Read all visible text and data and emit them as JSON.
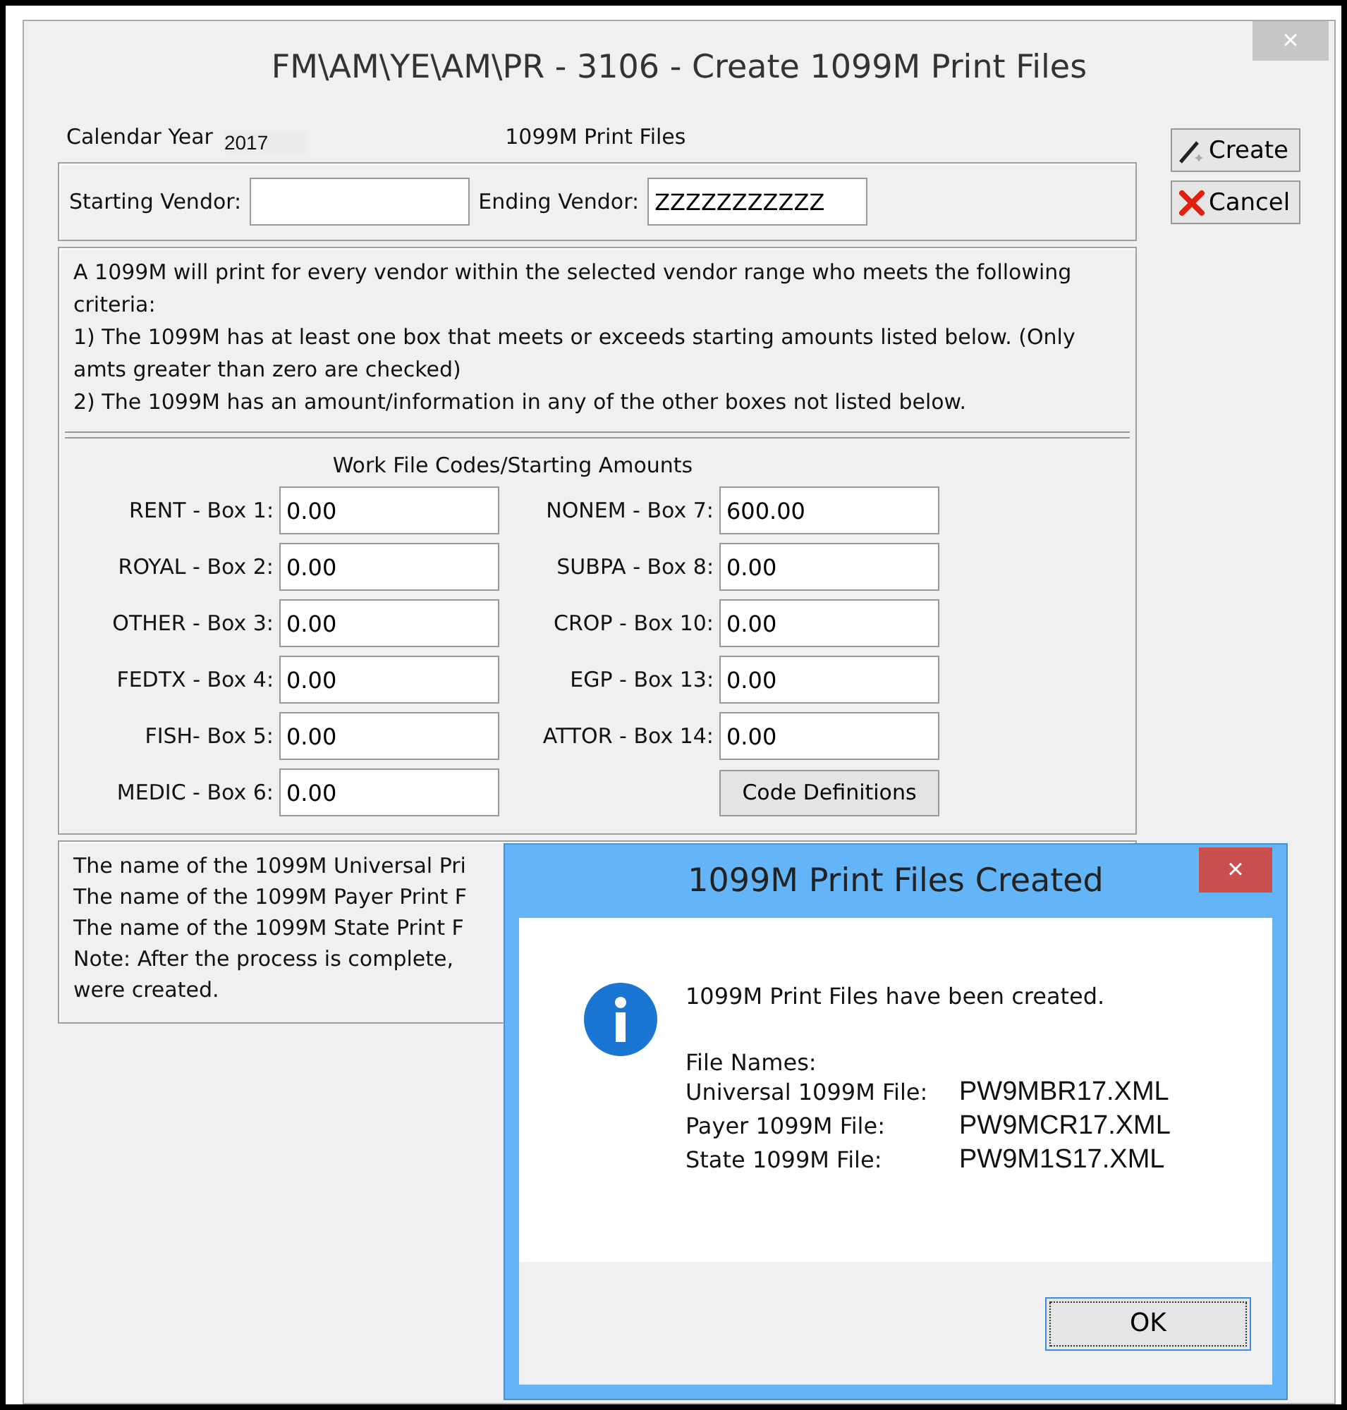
{
  "window": {
    "title": "FM\\AM\\YE\\AM\\PR - 3106 - Create 1099M Print Files",
    "close": "×"
  },
  "calendar_year": {
    "label": "Calendar Year",
    "value": "2017"
  },
  "heading": "1099M Print Files",
  "starting_vendor": {
    "label": "Starting Vendor:"
  },
  "ending_vendor": {
    "label": "Ending Vendor:",
    "value": "ZZZZZZZZZZZ"
  },
  "buttons": [
    {
      "label": "Create",
      "kind": "create"
    },
    {
      "label": "Cancel",
      "kind": "cancel"
    }
  ],
  "criteria": [
    "A 1099M will print for every vendor within the selected vendor range who meets the following criteria:",
    "1) The 1099M has at least one box that meets or exceeds starting amounts listed below. (Only amts greater than zero are checked)",
    "2) The 1099M has an amount/information in any of the other boxes not listed below."
  ],
  "codes_title": "Work File Codes/Starting Amounts",
  "codes_left": [
    {
      "label": "RENT - Box 1:",
      "value": "0.00"
    },
    {
      "label": "ROYAL - Box 2:",
      "value": "0.00"
    },
    {
      "label": "OTHER - Box 3:",
      "value": "0.00"
    },
    {
      "label": "FEDTX - Box 4:",
      "value": "0.00"
    },
    {
      "label": "FISH- Box 5:",
      "value": "0.00"
    },
    {
      "label": "MEDIC - Box 6:",
      "value": "0.00"
    }
  ],
  "codes_right": [
    {
      "label": "NONEM - Box 7:",
      "value": "600.00"
    },
    {
      "label": "SUBPA - Box 8:",
      "value": "0.00"
    },
    {
      "label": "CROP - Box 10:",
      "value": "0.00"
    },
    {
      "label": "EGP - Box 13:",
      "value": "0.00"
    },
    {
      "label": "ATTOR - Box 14:",
      "value": "0.00"
    }
  ],
  "code_definitions_button": "Code Definitions",
  "results": [
    "The name of the 1099M Universal Pri",
    "The name of the 1099M Payer Print F",
    "The name of the 1099M State Print F",
    "Note: After the process is complete,",
    "were created."
  ],
  "dialog": {
    "title": "1099M Print Files Created",
    "close": "×",
    "message": "1099M Print Files have been created.",
    "file_names_label": "File Names:",
    "files": [
      {
        "label": "Universal 1099M File:",
        "value": "PW9MBR17.XML"
      },
      {
        "label": "Payer 1099M File:",
        "value": "PW9MCR17.XML"
      },
      {
        "label": "State 1099M File:",
        "value": "PW9M1S17.XML"
      }
    ],
    "ok": "OK"
  }
}
